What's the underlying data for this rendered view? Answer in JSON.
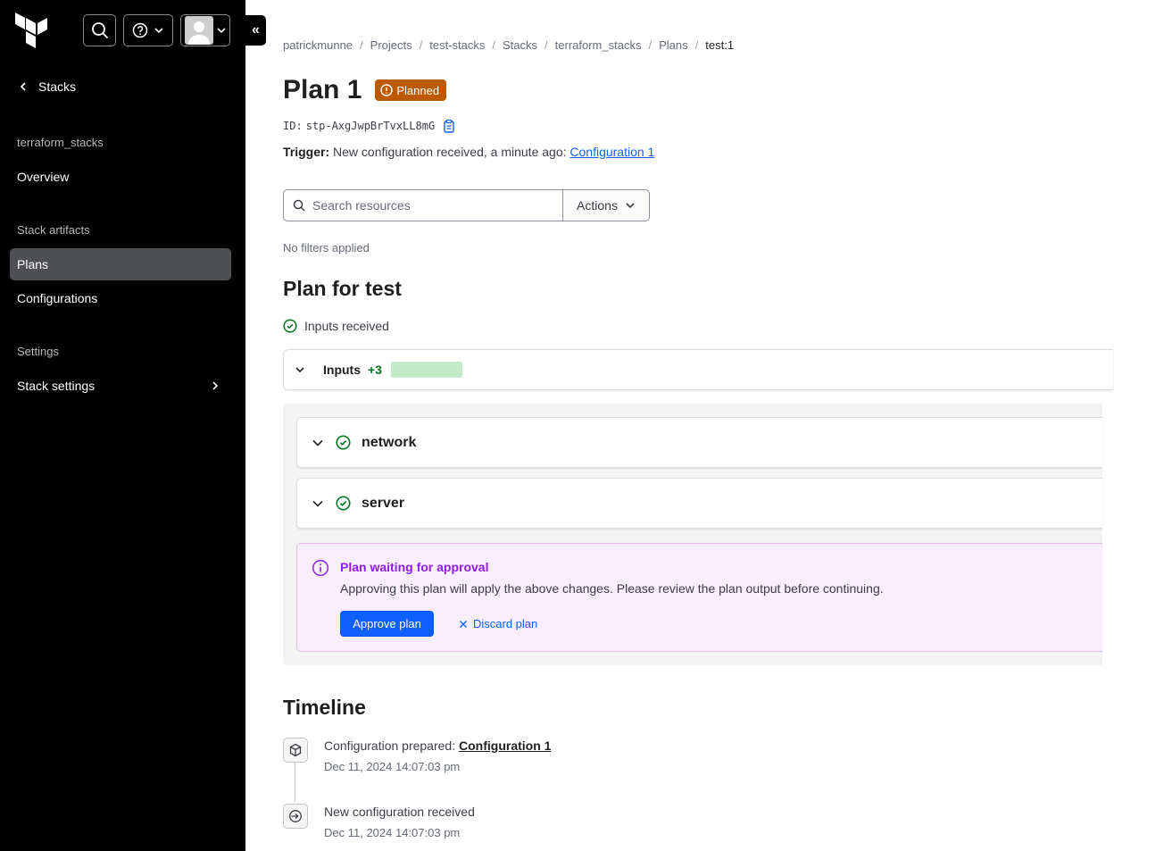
{
  "sidebar": {
    "back_label": "Stacks",
    "section_workspace": "terraform_stacks",
    "overview_label": "Overview",
    "section_artifacts": "Stack artifacts",
    "plans_label": "Plans",
    "configurations_label": "Configurations",
    "section_settings": "Settings",
    "stack_settings_label": "Stack settings"
  },
  "breadcrumb": [
    "patrickmunne",
    "Projects",
    "test-stacks",
    "Stacks",
    "terraform_stacks",
    "Plans",
    "test:1"
  ],
  "header": {
    "title": "Plan 1",
    "status": "Planned",
    "id_label": "ID:",
    "id_value": "stp-AxgJwpBrTvxLL8mG",
    "trigger_label": "Trigger:",
    "trigger_text": "New configuration received, a minute ago:",
    "trigger_link": "Configuration 1"
  },
  "search": {
    "placeholder": "Search resources",
    "actions_label": "Actions",
    "filters_text": "No filters applied"
  },
  "plan": {
    "title": "Plan for test",
    "inputs_status": "Inputs received",
    "inputs_label": "Inputs",
    "inputs_count": "+3",
    "components": [
      "network",
      "server"
    ]
  },
  "approval": {
    "title": "Plan waiting for approval",
    "description": "Approving this plan will apply the above changes. Please review the plan output before continuing.",
    "approve_label": "Approve plan",
    "discard_label": "Discard plan"
  },
  "timeline": {
    "title": "Timeline",
    "items": [
      {
        "text": "Configuration prepared:",
        "link": "Configuration 1",
        "time": "Dec 11, 2024 14:07:03 pm"
      },
      {
        "text": "New configuration received",
        "time": "Dec 11, 2024 14:07:03 pm"
      }
    ]
  },
  "colors": {
    "sidebar_bg": "#000000",
    "badge_planned": "#bb5a00",
    "primary": "#1060ff",
    "success": "#00781e",
    "highlight": "#911ced"
  }
}
